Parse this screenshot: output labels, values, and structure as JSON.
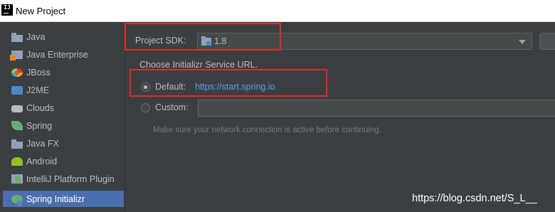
{
  "window": {
    "title": "New Project",
    "app_icon_text": "IJ"
  },
  "sidebar": {
    "items": [
      {
        "label": "Java",
        "icon": "folder-icon"
      },
      {
        "label": "Java Enterprise",
        "icon": "java-enterprise-icon"
      },
      {
        "label": "JBoss",
        "icon": "jboss-icon"
      },
      {
        "label": "J2ME",
        "icon": "j2me-icon"
      },
      {
        "label": "Clouds",
        "icon": "cloud-icon"
      },
      {
        "label": "Spring",
        "icon": "spring-leaf-icon"
      },
      {
        "label": "Java FX",
        "icon": "folder-icon"
      },
      {
        "label": "Android",
        "icon": "android-icon"
      },
      {
        "label": "IntelliJ Platform Plugin",
        "icon": "plugin-icon"
      },
      {
        "label": "Spring Initializr",
        "icon": "spring-initializr-icon",
        "selected": true
      }
    ]
  },
  "main": {
    "sdk_label": "Project SDK:",
    "sdk_value": "1.8",
    "service_url_heading": "Choose Initializr Service URL.",
    "default_option": {
      "label": "Default:",
      "url": "https://start.spring.io",
      "checked": true
    },
    "custom_option": {
      "label": "Custom:",
      "value": "",
      "checked": false
    },
    "hint": "Make sure your network connection is active before continuing."
  },
  "watermark": "https://blog.csdn.net/S_L__",
  "colors": {
    "background": "#3c3f41",
    "selection": "#4b6eaf",
    "link": "#589df6",
    "highlight_box": "#e8262a"
  }
}
